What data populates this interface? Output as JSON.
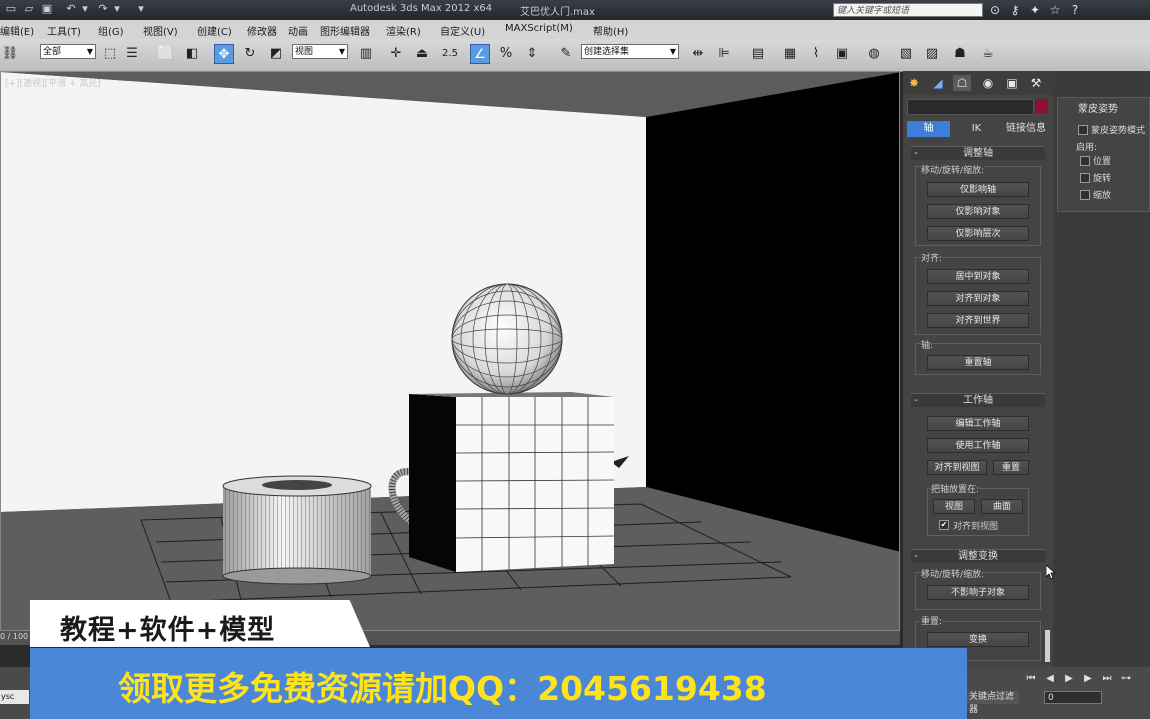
{
  "titlebar": {
    "app_title": "Autodesk 3ds Max  2012 x64",
    "file_title": "艾巴优人门.max",
    "search_placeholder": "键入关键字或短语",
    "quick_access_icons": [
      "new-scene-icon",
      "open-folder-icon",
      "save-icon",
      "undo-icon",
      "redo-icon",
      "dropdown-icon"
    ],
    "right_icons": [
      "binoculars-icon",
      "key-icon",
      "star-icon",
      "favorites-icon",
      "help-icon"
    ]
  },
  "menu": {
    "items": [
      "编辑(E)",
      "工具(T)",
      "组(G)",
      "视图(V)",
      "创建(C)",
      "修改器",
      "动画",
      "图形编辑器",
      "渲染(R)",
      "自定义(U)",
      "MAXScript(M)",
      "帮助(H)"
    ]
  },
  "toolbar": {
    "selection_filter": "全部",
    "ref_coord": "视图",
    "snap_value": "2.5",
    "named_selection": "创建选择集"
  },
  "viewport": {
    "label": "[+][透视][平滑 + 高光]"
  },
  "command_panel": {
    "tab_icons": [
      "create-tab-icon",
      "modify-tab-icon",
      "hierarchy-tab-icon",
      "motion-tab-icon",
      "display-tab-icon",
      "utilities-tab-icon"
    ],
    "hierarchy_tabs": [
      "轴",
      "IK",
      "链接信息"
    ],
    "selected_tab": "轴",
    "object_color": "#8e0f32",
    "adjust_pivot": {
      "title": "调整轴",
      "move_group": "移动/旋转/缩放:",
      "btn_affect_pivot": "仅影响轴",
      "btn_affect_object": "仅影响对象",
      "btn_affect_hierarchy": "仅影响层次",
      "align_group": "对齐:",
      "btn_center": "居中到对象",
      "btn_align_object": "对齐到对象",
      "btn_align_world": "对齐到世界",
      "pivot_group": "轴:",
      "btn_reset_pivot": "重置轴"
    },
    "working_pivot": {
      "title": "工作轴",
      "btn_edit": "编辑工作轴",
      "btn_use": "使用工作轴",
      "btn_align_view": "对齐到视图",
      "btn_reset": "重置",
      "place_group": "把轴放置在:",
      "btn_view": "视图",
      "btn_surface": "曲面",
      "chk_align_view": "对齐到视图"
    },
    "adjust_transform": {
      "title": "调整变换",
      "move_group": "移动/旋转/缩放:",
      "btn_dont_affect": "不影响子对象",
      "reset_group": "重置:",
      "btn_transform": "变换"
    }
  },
  "skin_pose": {
    "title": "蒙皮姿势",
    "chk_enabled": "蒙皮姿势模式",
    "enable_group": "启用:",
    "chk_position": "位置",
    "chk_rotation": "旋转",
    "chk_scale": "缩放"
  },
  "bottom": {
    "frame_count": "0 / 100",
    "maxscript_prompt": "ysc",
    "filter_label": "关键点过滤器",
    "frame_value": "0",
    "playback_icons": [
      "go-start-icon",
      "prev-frame-icon",
      "play-icon",
      "next-frame-icon",
      "go-end-icon",
      "key-mode-icon"
    ]
  },
  "overlay": {
    "banner_small": "教程+软件+模型",
    "banner_large": "领取更多免费资源请加QQ：2045619438"
  }
}
